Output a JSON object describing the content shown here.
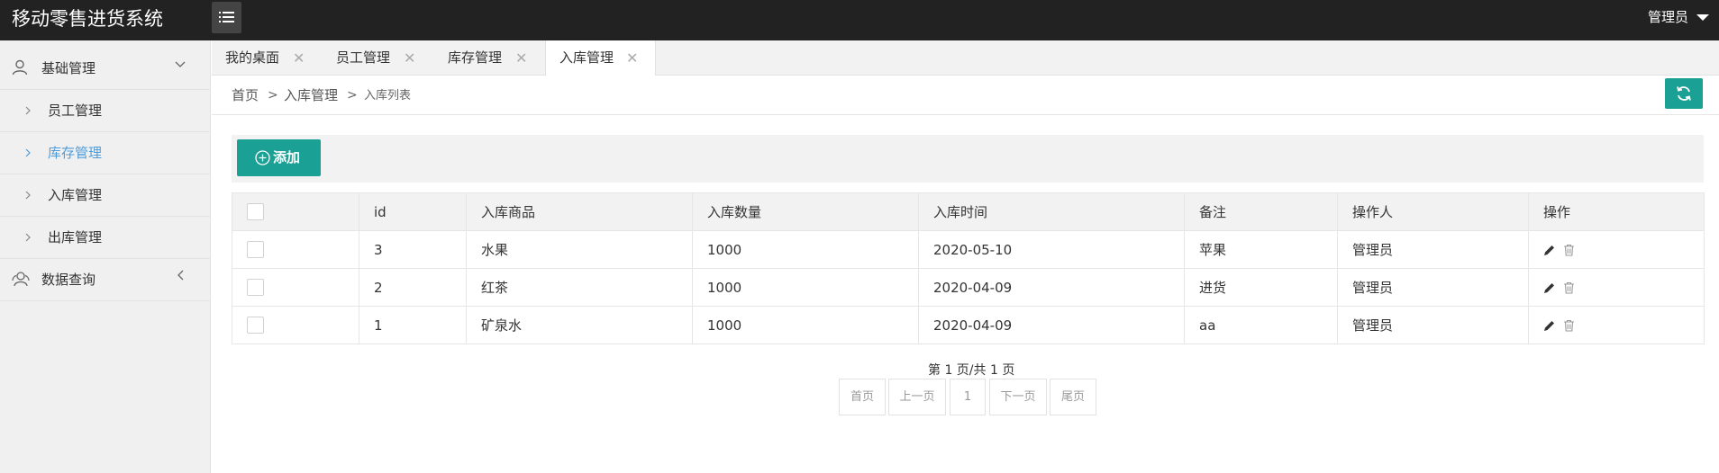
{
  "app": {
    "title": "移动零售进货系统",
    "user": "管理员"
  },
  "sidebar": {
    "groups": [
      {
        "label": "基础管理",
        "items": [
          {
            "label": "员工管理"
          },
          {
            "label": "库存管理"
          },
          {
            "label": "入库管理"
          },
          {
            "label": "出库管理"
          }
        ]
      },
      {
        "label": "数据查询"
      }
    ],
    "active_item": "库存管理"
  },
  "tabs": [
    {
      "label": "我的桌面"
    },
    {
      "label": "员工管理"
    },
    {
      "label": "库存管理"
    },
    {
      "label": "入库管理"
    }
  ],
  "breadcrumb": {
    "items": [
      "首页",
      "入库管理",
      "入库列表"
    ],
    "separator": ">"
  },
  "toolbar": {
    "add_label": "添加"
  },
  "table": {
    "columns": [
      "id",
      "入库商品",
      "入库数量",
      "入库时间",
      "备注",
      "操作人",
      "操作"
    ],
    "rows": [
      {
        "id": "3",
        "product": "水果",
        "quantity": "1000",
        "time": "2020-05-10",
        "note": "苹果",
        "operator": "管理员"
      },
      {
        "id": "2",
        "product": "红茶",
        "quantity": "1000",
        "time": "2020-04-09",
        "note": "进货",
        "operator": "管理员"
      },
      {
        "id": "1",
        "product": "矿泉水",
        "quantity": "1000",
        "time": "2020-04-09",
        "note": "aa",
        "operator": "管理员"
      }
    ]
  },
  "pagination": {
    "info": "第 1 页/共 1 页",
    "first": "首页",
    "prev": "上一页",
    "current": "1",
    "next": "下一页",
    "last": "尾页"
  },
  "colors": {
    "topbar": "#222222",
    "accent": "#1aa094",
    "active_link": "#4e9bd8"
  }
}
